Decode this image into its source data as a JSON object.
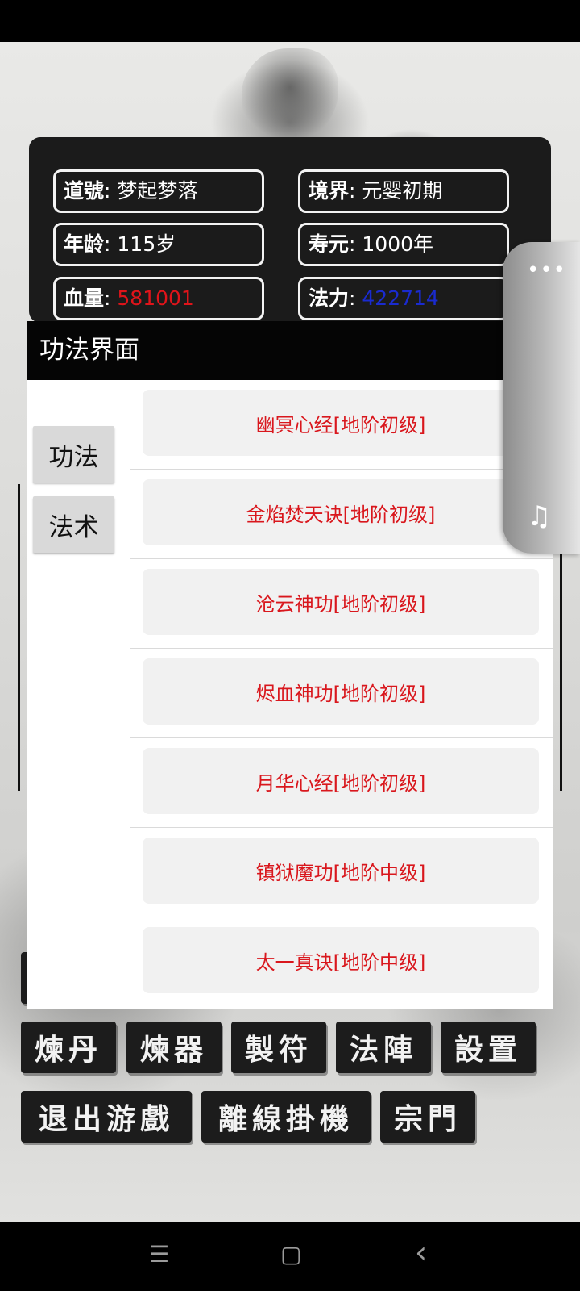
{
  "info": {
    "title_label": "道號",
    "title_value": "梦起梦落",
    "realm_label": "境界",
    "realm_value": "元婴初期",
    "age_label": "年龄",
    "age_value": "115岁",
    "lifespan_label": "寿元",
    "lifespan_value": "1000年",
    "hp_label": "血量",
    "hp_value": "581001",
    "mana_label": "法力",
    "mana_value": "422714"
  },
  "dialog": {
    "title": "功法界面",
    "tabs": [
      "功法",
      "法术"
    ],
    "items": [
      "幽冥心经[地阶初级]",
      "金焰焚天诀[地阶初级]",
      "沧云神功[地阶初级]",
      "烬血神功[地阶初级]",
      "月华心经[地阶初级]",
      "镇狱魔功[地阶中级]",
      "太一真诀[地阶中级]"
    ]
  },
  "menu": {
    "row1": [
      "煉丹",
      "煉器",
      "製符",
      "法陣",
      "設置"
    ],
    "row2": [
      "退出游戲",
      "離線掛機",
      "宗門"
    ]
  },
  "colors": {
    "hp": "#e0141a",
    "mana": "#1a2bd0",
    "item_text": "#d9171d"
  },
  "icons": {
    "float_more": "more-dots-icon",
    "float_music": "music-note-icon",
    "nav_menu": "menu-icon",
    "nav_home": "home-icon",
    "nav_back": "back-icon"
  },
  "glyphs": {
    "more": "•••",
    "music": "♫",
    "menu": "☰",
    "home": "▢",
    "back": "‹"
  }
}
